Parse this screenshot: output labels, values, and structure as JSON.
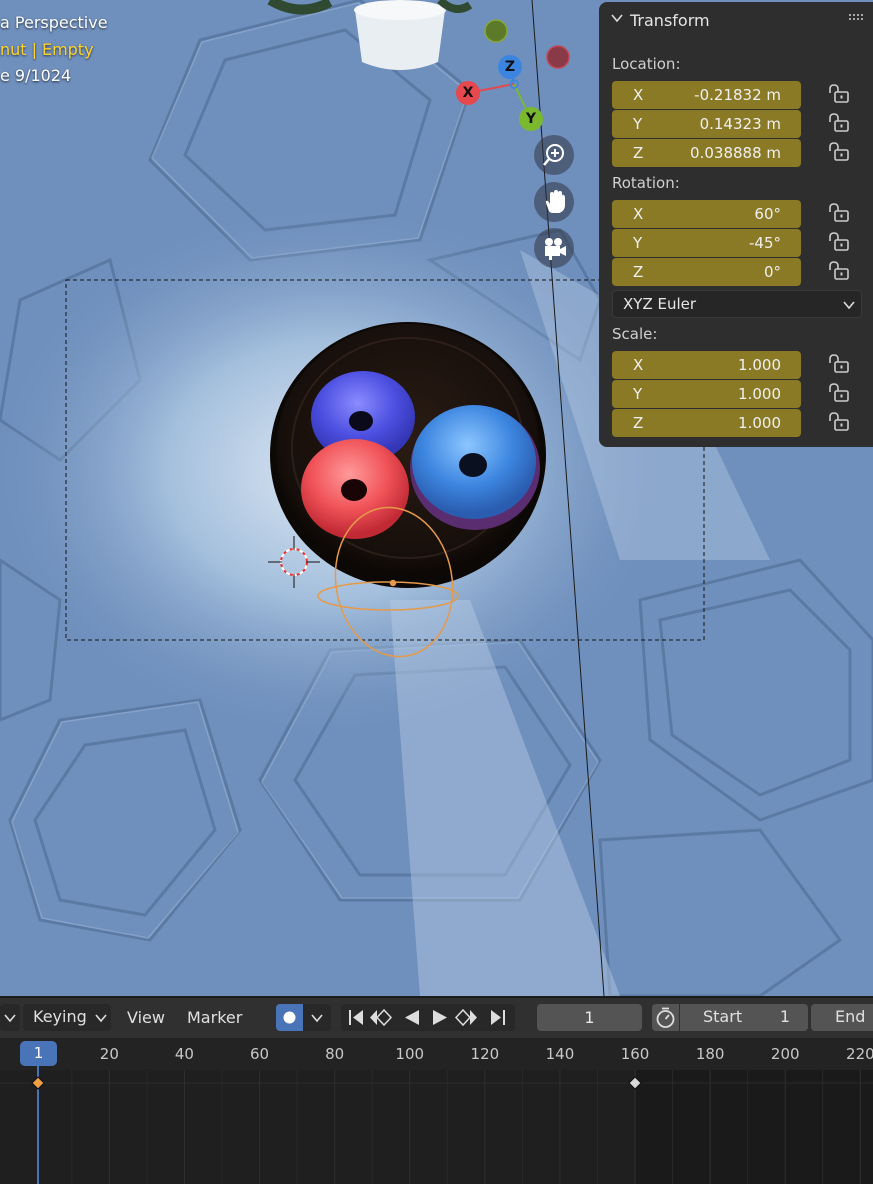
{
  "viewport": {
    "view_title": "a Perspective",
    "object_name": "nut",
    "object_type": "Empty",
    "render_samples": "e 9/1024",
    "gizmo": {
      "x_label": "X",
      "y_label": "Y",
      "z_label": "Z"
    },
    "nav_buttons": [
      "zoom-icon",
      "hand-pan-icon",
      "camera-icon"
    ]
  },
  "transform_panel": {
    "title": "Transform",
    "location_label": "Location:",
    "location": [
      {
        "axis": "X",
        "value": "-0.21832 m"
      },
      {
        "axis": "Y",
        "value": "0.14323 m"
      },
      {
        "axis": "Z",
        "value": "0.038888 m"
      }
    ],
    "rotation_label": "Rotation:",
    "rotation": [
      {
        "axis": "X",
        "value": "60°"
      },
      {
        "axis": "Y",
        "value": "-45°"
      },
      {
        "axis": "Z",
        "value": "0°"
      }
    ],
    "rotation_mode": "XYZ Euler",
    "scale_label": "Scale:",
    "scale": [
      {
        "axis": "X",
        "value": "1.000"
      },
      {
        "axis": "Y",
        "value": "1.000"
      },
      {
        "axis": "Z",
        "value": "1.000"
      }
    ],
    "accent_color": "#8a7a25"
  },
  "timeline": {
    "menus": {
      "keying": "Keying",
      "view": "View",
      "marker": "Marker"
    },
    "current_frame": "1",
    "start_label": "Start",
    "start_value": "1",
    "end_label": "End",
    "ruler_ticks": [
      "20",
      "40",
      "60",
      "80",
      "100",
      "120",
      "140",
      "160",
      "180",
      "200",
      "220"
    ],
    "playhead_frame": "1",
    "keyframe_frames": [
      1,
      160
    ],
    "playhead_color": "#4a74b8"
  }
}
